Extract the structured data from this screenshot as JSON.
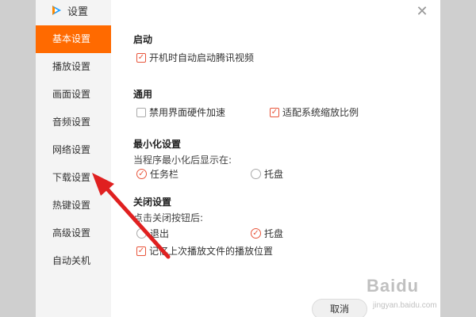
{
  "window": {
    "title": "设置"
  },
  "sidebar": {
    "items": [
      {
        "label": "基本设置",
        "active": true
      },
      {
        "label": "播放设置"
      },
      {
        "label": "画面设置"
      },
      {
        "label": "音频设置"
      },
      {
        "label": "网络设置"
      },
      {
        "label": "下载设置"
      },
      {
        "label": "热键设置"
      },
      {
        "label": "高级设置"
      },
      {
        "label": "自动关机"
      }
    ]
  },
  "main": {
    "startup": {
      "title": "启动",
      "auto_start": {
        "label": "开机时自动启动腾讯视频",
        "checked": true
      }
    },
    "general": {
      "title": "通用",
      "hw_accel": {
        "label": "禁用界面硬件加速",
        "checked": false
      },
      "dpi_scale": {
        "label": "适配系统缩放比例",
        "checked": true
      }
    },
    "minimize": {
      "title": "最小化设置",
      "hint": "当程序最小化后显示在:",
      "taskbar": {
        "label": "任务栏",
        "selected": true
      },
      "tray": {
        "label": "托盘",
        "selected": false
      }
    },
    "close": {
      "title": "关闭设置",
      "hint": "点击关闭按钮后:",
      "exit": {
        "label": "退出",
        "selected": false
      },
      "tray": {
        "label": "托盘",
        "selected": true
      },
      "remember_pos": {
        "label": "记忆上次播放文件的播放位置",
        "checked": true
      }
    }
  },
  "footer": {
    "cancel_label": "取消"
  },
  "watermark": {
    "text": "Baidu",
    "sub": "jingyan.baidu.com"
  },
  "colors": {
    "accent": "#ff6a00",
    "check": "#e8553b",
    "arrow": "#e02020"
  }
}
